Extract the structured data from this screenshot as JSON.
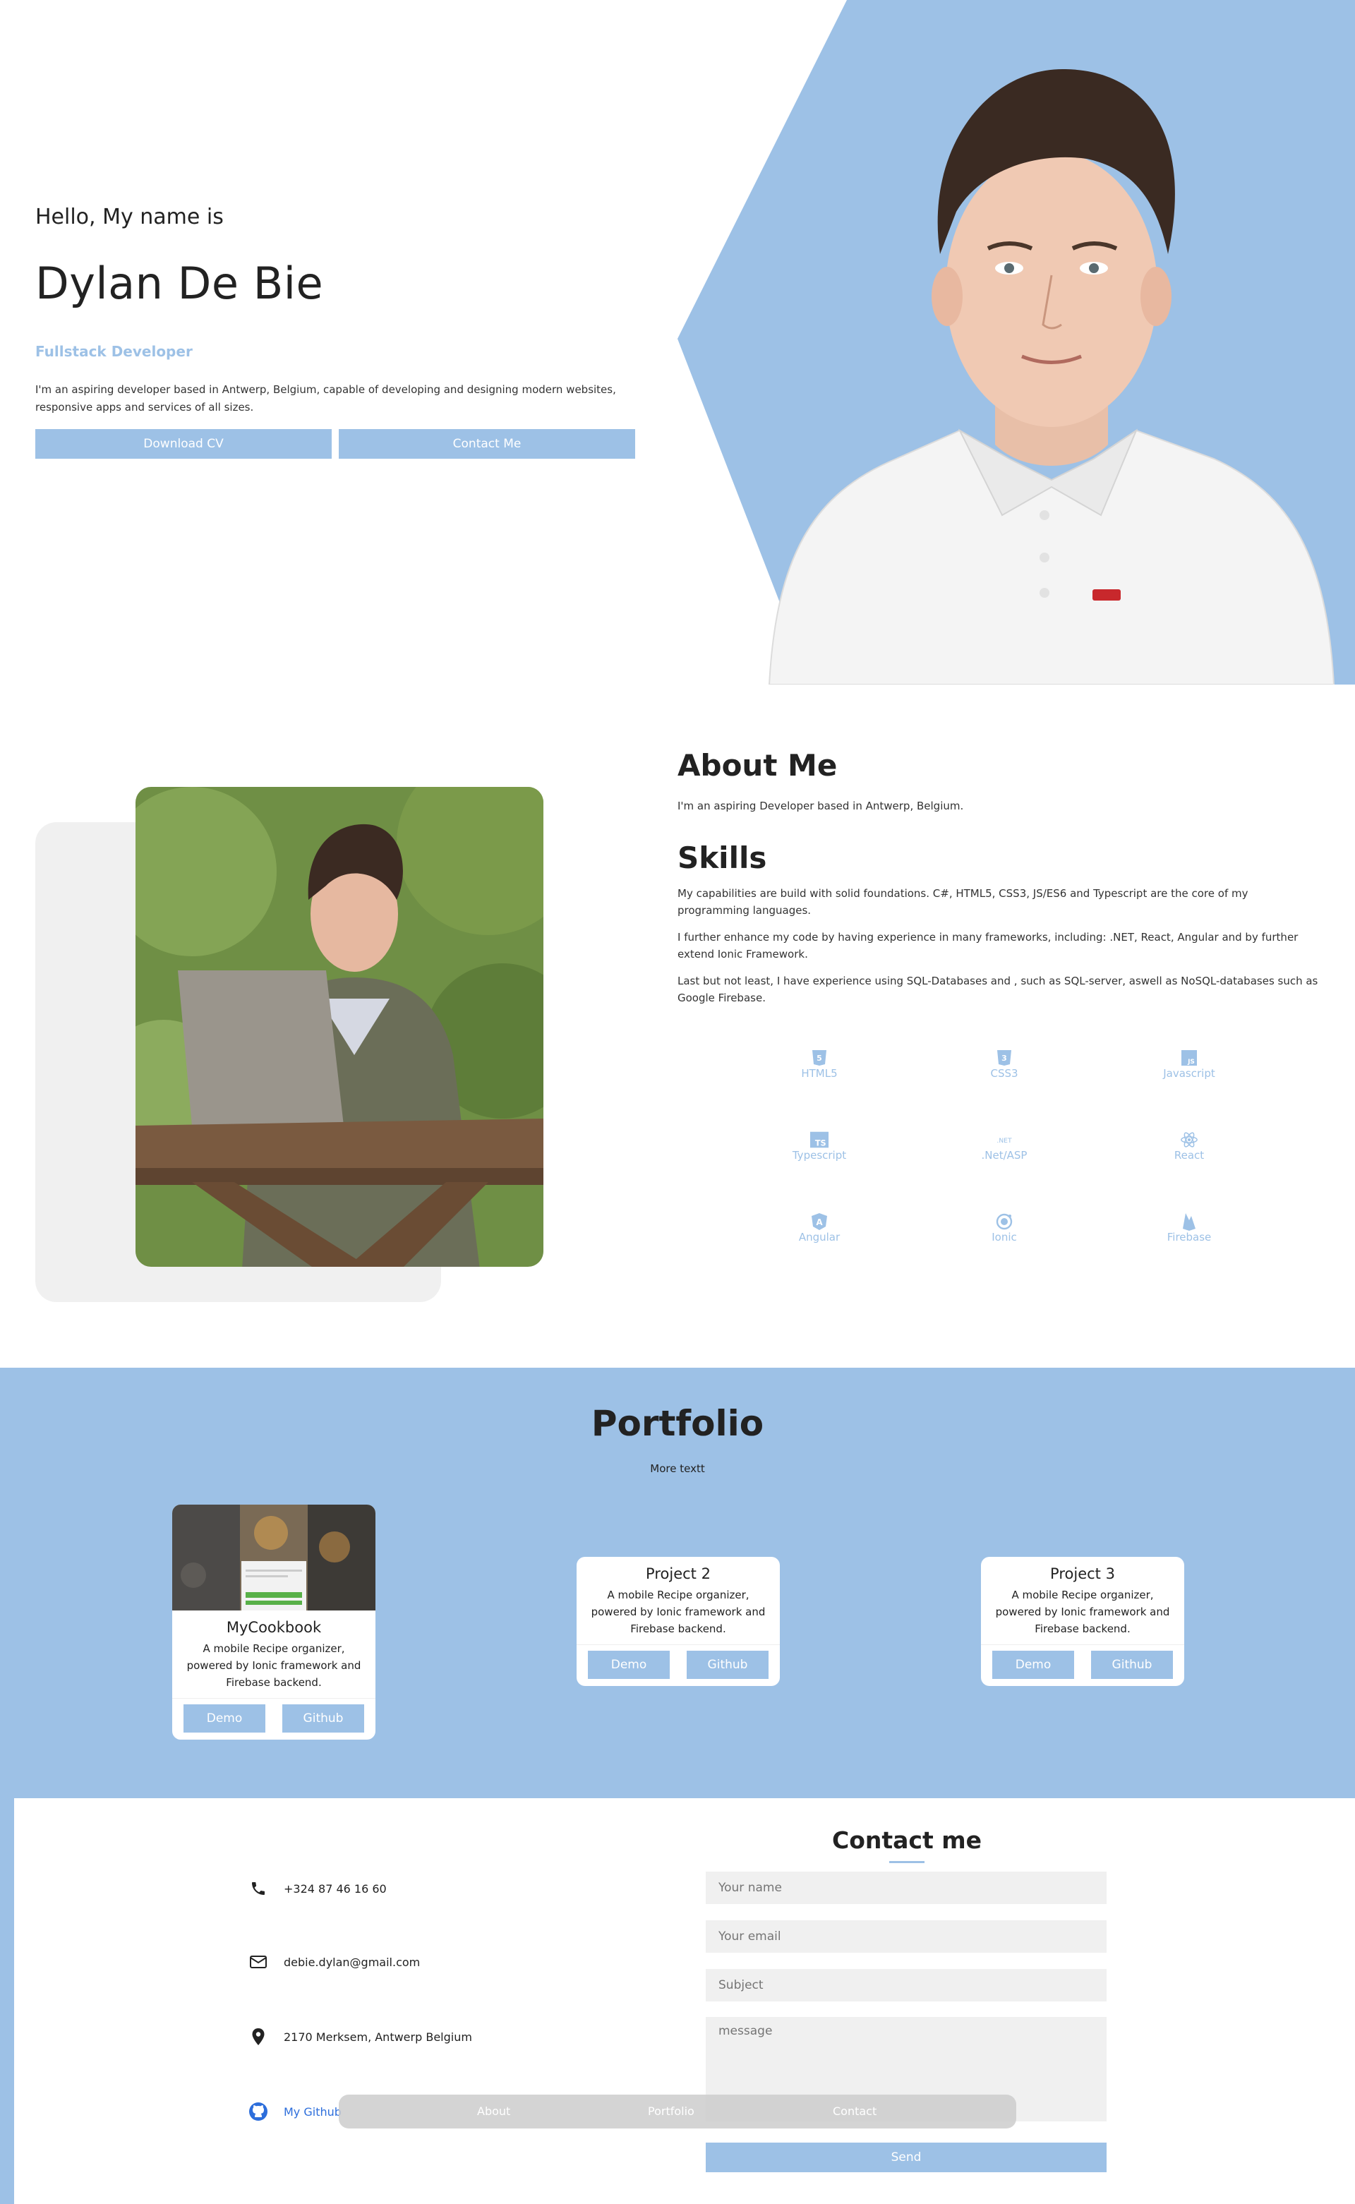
{
  "hero": {
    "greeting": "Hello, My name is",
    "name": "Dylan De Bie",
    "role": "Fullstack Developer",
    "bio": "I'm an aspiring developer based in Antwerp, Belgium, capable of developing and designing modern websites, responsive apps and services of all sizes.",
    "download_cv": "Download CV",
    "contact_me": "Contact Me"
  },
  "about": {
    "title": "About Me",
    "line": "I'm an aspiring Developer based in Antwerp, Belgium.",
    "skills_title": "Skills",
    "p1": "My capabilities are build with solid foundations. C#, HTML5, CSS3, JS/ES6 and Typescript are the core of my programming languages.",
    "p2": "I further enhance my code by having experience in many frameworks, including: .NET, React, Angular and by further extend Ionic Framework.",
    "p3": "Last but not least, I have experience using SQL-Databases and , such as SQL-server, aswell as NoSQL-databases such as Google Firebase."
  },
  "skills": [
    {
      "label": "HTML5",
      "icon": "html5-icon",
      "glyph": "5"
    },
    {
      "label": "CSS3",
      "icon": "css3-icon",
      "glyph": "3"
    },
    {
      "label": "Javascript",
      "icon": "javascript-icon",
      "glyph": "JS"
    },
    {
      "label": "Typescript",
      "icon": "typescript-icon",
      "glyph": "TS"
    },
    {
      "label": ".Net/ASP",
      "icon": "dotnet-icon",
      "glyph": ".NET"
    },
    {
      "label": "React",
      "icon": "react-icon",
      "glyph": "⚛"
    },
    {
      "label": "Angular",
      "icon": "angular-icon",
      "glyph": "A"
    },
    {
      "label": "Ionic",
      "icon": "ionic-icon",
      "glyph": "◉"
    },
    {
      "label": "Firebase",
      "icon": "firebase-icon",
      "glyph": "🔥"
    }
  ],
  "portfolio": {
    "title": "Portfolio",
    "subtitle": "More textt",
    "projects": [
      {
        "title": "MyCookbook",
        "desc": "A mobile Recipe organizer, powered by Ionic framework and Firebase backend.",
        "demo": "Demo",
        "github": "Github"
      },
      {
        "title": "Project 2",
        "desc": "A mobile Recipe organizer, powered by Ionic framework and Firebase backend.",
        "demo": "Demo",
        "github": "Github"
      },
      {
        "title": "Project 3",
        "desc": "A mobile Recipe organizer, powered by Ionic framework and Firebase backend.",
        "demo": "Demo",
        "github": "Github"
      }
    ]
  },
  "contact": {
    "title": "Contact me",
    "phone": "+324 87 46 16 60",
    "email": "debie.dylan@gmail.com",
    "address": "2170 Merksem, Antwerp Belgium",
    "github": "My Github",
    "name_placeholder": "Your name",
    "email_placeholder": "Your email",
    "subject_placeholder": "Subject",
    "message_placeholder": "message",
    "send": "Send"
  },
  "nav": {
    "about": "About",
    "portfolio": "Portfolio",
    "contact": "Contact"
  },
  "colors": {
    "accent": "#9dc1e6",
    "field_bg": "#f0f0f0",
    "github_link": "#2d6edb"
  }
}
